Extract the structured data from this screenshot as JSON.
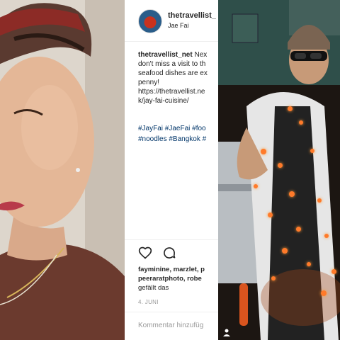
{
  "post": {
    "username": "thetravellist_",
    "location": "Jae Fai",
    "caption_user": "thetravellist_net",
    "caption_lines": [
      "Nex",
      "don't miss a visit to th",
      "seafood dishes are ex",
      "penny!",
      "https://thetravellist.ne",
      "k/jay-fai-cuisine/"
    ],
    "tags_lines": [
      "#JayFai #JaeFai #foo",
      "#noodles #Bangkok #"
    ],
    "likes_lines": [
      "fayminine, marzlet, p",
      "peeraratphoto, robe",
      "gefällt das"
    ],
    "date": "4. JUNI",
    "comment_placeholder": "Kommentar hinzufüg"
  },
  "icons": {
    "like": "heart-icon",
    "comment": "comment-icon",
    "profile": "profile-icon"
  },
  "colors": {
    "link": "#003569",
    "text": "#262626",
    "muted": "#999999"
  }
}
